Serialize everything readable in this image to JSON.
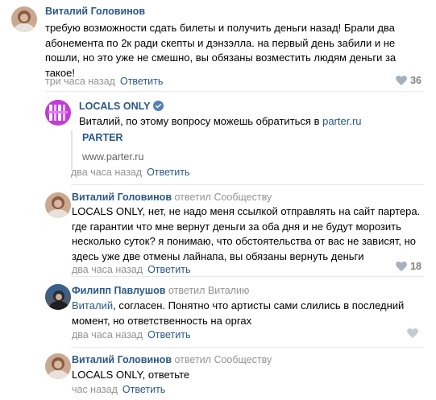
{
  "comments": [
    {
      "author": "Виталий Головинов",
      "text": "требую возможности сдать билеты и получить деньги назад! Брали два абонемента по 2к ради скепты и дэнзэлла. на первый день забили и не пошли, но это уже не смешно, вы обязаны возместить людям деньги за такое!",
      "time": "три часа назад",
      "reply_label": "Ответить",
      "likes": "36"
    },
    {
      "author": "LOCALS ONLY",
      "text_before_link": "Виталий, по этому вопросу можешь обратиться в ",
      "link_text": "parter.ru",
      "snippet_title": "PARTER",
      "snippet_url": "www.parter.ru",
      "time": "два часа назад",
      "reply_label": "Ответить"
    },
    {
      "author": "Виталий Головинов",
      "replied_word": "ответил",
      "replied_to": "Сообществу",
      "text": "LOCALS ONLY, нет, не надо меня ссылкой отправлять на сайт партера. где гарантии что мне вернут деньги за оба дня и не будут морозить несколько суток? я понимаю, что обстоятельства от вас не зависят, но здесь уже две отмены лайнапа, вы обязаны вернуть деньги",
      "time": "два часа назад",
      "reply_label": "Ответить",
      "likes": "18"
    },
    {
      "author": "Филипп Павлушов",
      "replied_word": "ответил",
      "replied_to": "Виталию",
      "text_link": "Виталий",
      "text": ", согласен. Понятно что артисты сами слились в последний момент, но ответственность на оргах",
      "time": "два часа назад",
      "reply_label": "Ответить"
    },
    {
      "author": "Виталий Головинов",
      "replied_word": "ответил",
      "replied_to": "Сообществу",
      "text": "LOCALS ONLY, ответьте",
      "time": "час назад",
      "reply_label": "Ответить"
    }
  ],
  "colors": {
    "link": "#2a5885",
    "meta": "#939393",
    "verified": "#5181b8",
    "locals_logo_bg": "#c23bd4"
  },
  "icons": [
    "heart-icon",
    "verified-icon",
    "locals-only-logo"
  ]
}
